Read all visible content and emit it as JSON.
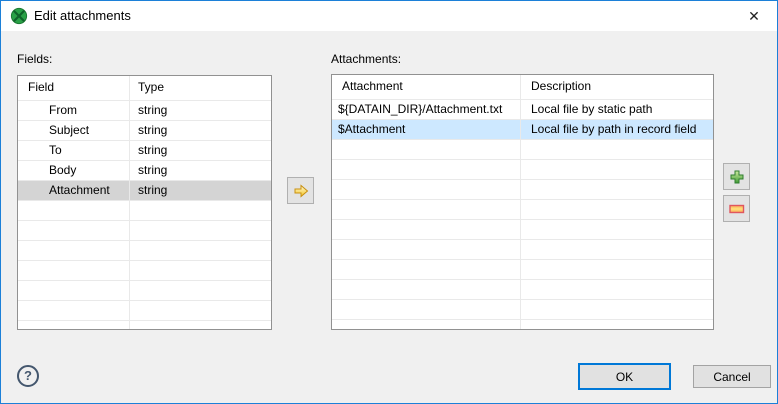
{
  "window": {
    "title": "Edit attachments",
    "close_glyph": "✕"
  },
  "colors": {
    "window_border": "#1c80d8",
    "titlebar_bg": "#ffffff",
    "dialog_bg": "#f0f0f0",
    "selection_active": "#cde8ff",
    "selection_inactive": "#d4d4d4",
    "table_border": "#919191",
    "grid_line": "#e9e9e9",
    "ok_focus_border": "#0078d7"
  },
  "fields_panel": {
    "label": "Fields:",
    "columns": [
      "Field",
      "Type"
    ],
    "rows": [
      [
        "From",
        "string"
      ],
      [
        "Subject",
        "string"
      ],
      [
        "To",
        "string"
      ],
      [
        "Body",
        "string"
      ],
      [
        "Attachment",
        "string"
      ]
    ],
    "selected_index": 4,
    "selection_style": "inactive",
    "empty_rows": 8
  },
  "attachments_panel": {
    "label": "Attachments:",
    "columns": [
      "Attachment",
      "Description"
    ],
    "rows": [
      [
        "${DATAIN_DIR}/Attachment.txt",
        "Local file by static path"
      ],
      [
        "$Attachment",
        "Local file by path in record field"
      ]
    ],
    "selected_index": 1,
    "selection_style": "active",
    "empty_rows": 11
  },
  "actions": {
    "help_glyph": "?",
    "ok": "OK",
    "cancel": "Cancel"
  }
}
